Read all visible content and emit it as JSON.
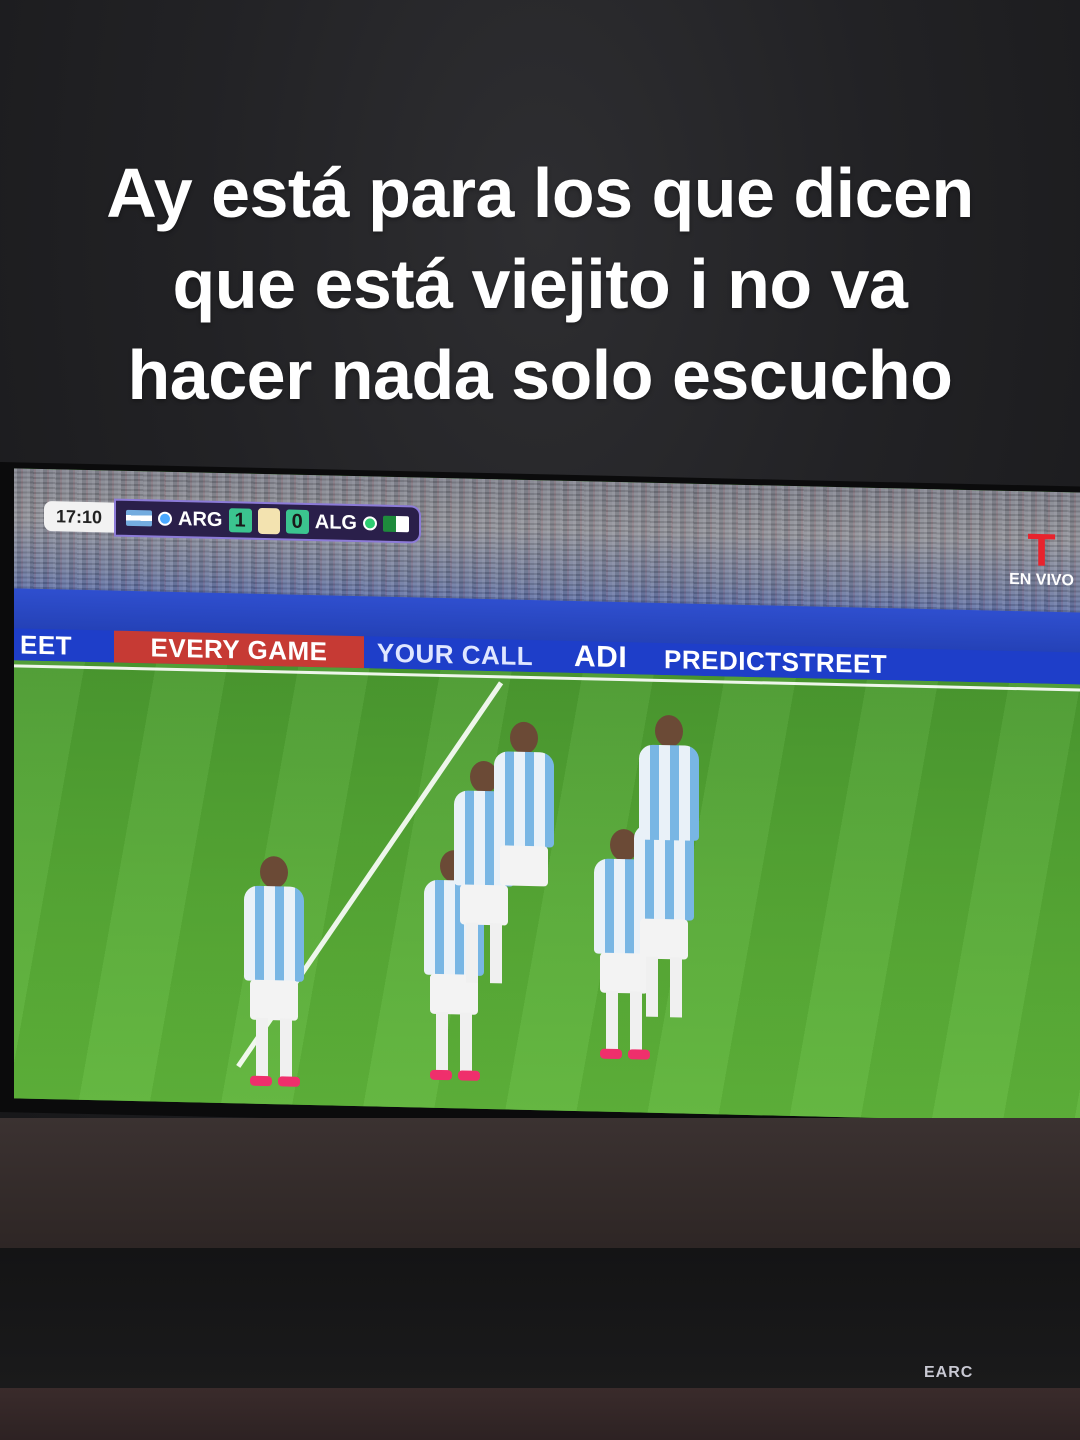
{
  "caption": {
    "line1": "Ay está para los que dicen",
    "line2": "que está viejito i no va",
    "line3": "hacer nada solo escucho"
  },
  "scorebug": {
    "clock": "17:10",
    "home_team": "ARG",
    "home_score": "1",
    "away_score": "0",
    "away_team": "ALG"
  },
  "broadcaster": {
    "status": "EN VIVO"
  },
  "ad_boards": {
    "b1": "EET",
    "b2": "EVERY GAME",
    "b3": "YOUR CALL",
    "b4": "ADI",
    "b5": "PREDICTSTREET"
  },
  "device_label": "EARC",
  "colors": {
    "pitch": "#56a935",
    "board_blue": "#1e3ec9",
    "board_red": "#c63a34",
    "scorebug_purple": "#2a1f4a",
    "score_green": "#3bc48f"
  }
}
